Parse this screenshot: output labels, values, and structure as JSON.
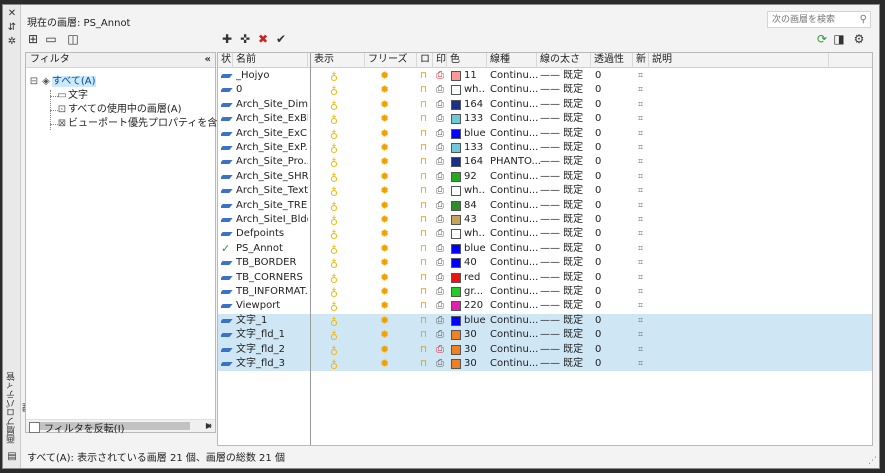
{
  "palette": {
    "window_bg": "#f3f3f3",
    "selected_row": "#cfe7f5",
    "accent_green": "#2d9a3a"
  },
  "window": {
    "vertical_title": "画層プロパティ管理",
    "current_layer": "現在の画層: PS_Annot"
  },
  "search": {
    "placeholder": "次の画層を検索"
  },
  "filter_panel": {
    "header": "フィルタ",
    "collapse_label": "«",
    "tree": [
      {
        "label": "すべて(A)",
        "expander": "⊟"
      },
      {
        "label": "文字"
      },
      {
        "label": "すべての使用中の画層(A)"
      },
      {
        "label": "ビューポート優先プロパティを含む画層("
      }
    ],
    "invert_label": "フィルタを反転(I)"
  },
  "columns": [
    "状",
    "名前",
    "表示",
    "フリーズ",
    "ロ",
    "印",
    "色",
    "線種",
    "線の太さ",
    "透過性",
    "新",
    "説明"
  ],
  "layers": [
    {
      "status": "para",
      "name": "_Hojyo",
      "color": "#ff9999",
      "color_name": "11",
      "plot": "no",
      "linetype": "Continu...",
      "lineweight": "—— 既定",
      "transparency": "0",
      "hl": false
    },
    {
      "status": "para",
      "name": "0",
      "color": "#ffffff",
      "color_name": "wh...",
      "plot": "yes",
      "linetype": "Continu...",
      "lineweight": "—— 既定",
      "transparency": "0",
      "hl": false
    },
    {
      "status": "para",
      "name": "Arch_Site_Dim...",
      "color": "#1a2f8a",
      "color_name": "164",
      "plot": "yes",
      "linetype": "Continu...",
      "lineweight": "—— 既定",
      "transparency": "0",
      "hl": false
    },
    {
      "status": "para",
      "name": "Arch_Site_ExBl...",
      "color": "#6fc8d8",
      "color_name": "133",
      "plot": "yes",
      "linetype": "Continu...",
      "lineweight": "—— 既定",
      "transparency": "0",
      "hl": false
    },
    {
      "status": "para",
      "name": "Arch_Site_ExC...",
      "color": "#0000ff",
      "color_name": "blue",
      "plot": "yes",
      "linetype": "Continu...",
      "lineweight": "—— 既定",
      "transparency": "0",
      "hl": false
    },
    {
      "status": "para",
      "name": "Arch_Site_ExP...",
      "color": "#6fc8d8",
      "color_name": "133",
      "plot": "yes",
      "linetype": "Continu...",
      "lineweight": "—— 既定",
      "transparency": "0",
      "hl": false
    },
    {
      "status": "para",
      "name": "Arch_Site_Pro...",
      "color": "#1a2f8a",
      "color_name": "164",
      "plot": "yes",
      "linetype": "PHANTO...",
      "lineweight": "—— 既定",
      "transparency": "0",
      "hl": false
    },
    {
      "status": "para",
      "name": "Arch_Site_SHR...",
      "color": "#22aa22",
      "color_name": "92",
      "plot": "yes",
      "linetype": "Continu...",
      "lineweight": "—— 既定",
      "transparency": "0",
      "hl": false
    },
    {
      "status": "para",
      "name": "Arch_Site_Text",
      "color": "#ffffff",
      "color_name": "wh...",
      "plot": "yes",
      "linetype": "Continu...",
      "lineweight": "—— 既定",
      "transparency": "0",
      "hl": false
    },
    {
      "status": "para",
      "name": "Arch_Site_TRE...",
      "color": "#2e8b2e",
      "color_name": "84",
      "plot": "yes",
      "linetype": "Continu...",
      "lineweight": "—— 既定",
      "transparency": "0",
      "hl": false
    },
    {
      "status": "para",
      "name": "Arch_SiteI_Bldg.",
      "color": "#c8a45a",
      "color_name": "43",
      "plot": "yes",
      "linetype": "Continu...",
      "lineweight": "—— 既定",
      "transparency": "0",
      "hl": false
    },
    {
      "status": "para",
      "name": "Defpoints",
      "color": "#ffffff",
      "color_name": "wh...",
      "plot": "yes",
      "linetype": "Continu...",
      "lineweight": "—— 既定",
      "transparency": "0",
      "hl": false
    },
    {
      "status": "check",
      "name": "PS_Annot",
      "color": "#0000ff",
      "color_name": "blue",
      "plot": "yes",
      "linetype": "Continu...",
      "lineweight": "—— 既定",
      "transparency": "0",
      "hl": false
    },
    {
      "status": "para",
      "name": "TB_BORDER",
      "color": "#0000ff",
      "color_name": "40",
      "plot": "yes",
      "linetype": "Continu...",
      "lineweight": "—— 既定",
      "transparency": "0",
      "hl": false
    },
    {
      "status": "para",
      "name": "TB_CORNERS",
      "color": "#ee1111",
      "color_name": "red",
      "plot": "yes",
      "linetype": "Continu...",
      "lineweight": "—— 既定",
      "transparency": "0",
      "hl": false
    },
    {
      "status": "para",
      "name": "TB_INFORMAT...",
      "color": "#22cc22",
      "color_name": "gr...",
      "plot": "yes",
      "linetype": "Continu...",
      "lineweight": "—— 既定",
      "transparency": "0",
      "hl": false
    },
    {
      "status": "para",
      "name": "Viewport",
      "color": "#e020b0",
      "color_name": "220",
      "plot": "yes",
      "linetype": "Continu...",
      "lineweight": "—— 既定",
      "transparency": "0",
      "hl": false
    },
    {
      "status": "para",
      "name": "文字_1",
      "color": "#0000ff",
      "color_name": "blue",
      "plot": "yes",
      "linetype": "Continu...",
      "lineweight": "—— 既定",
      "transparency": "0",
      "hl": true
    },
    {
      "status": "para",
      "name": "文字_fld_1",
      "color": "#f08020",
      "color_name": "30",
      "plot": "yes",
      "linetype": "Continu...",
      "lineweight": "—— 既定",
      "transparency": "0",
      "hl": true
    },
    {
      "status": "para",
      "name": "文字_fld_2",
      "color": "#f08020",
      "color_name": "30",
      "plot": "no",
      "linetype": "Continu...",
      "lineweight": "—— 既定",
      "transparency": "0",
      "hl": true
    },
    {
      "status": "para",
      "name": "文字_fld_3",
      "color": "#f08020",
      "color_name": "30",
      "plot": "yes",
      "linetype": "Continu...",
      "lineweight": "—— 既定",
      "transparency": "0",
      "hl": true
    }
  ],
  "status_bar": "すべて(A): 表示されている画層 21 個、画層の総数 21 個"
}
